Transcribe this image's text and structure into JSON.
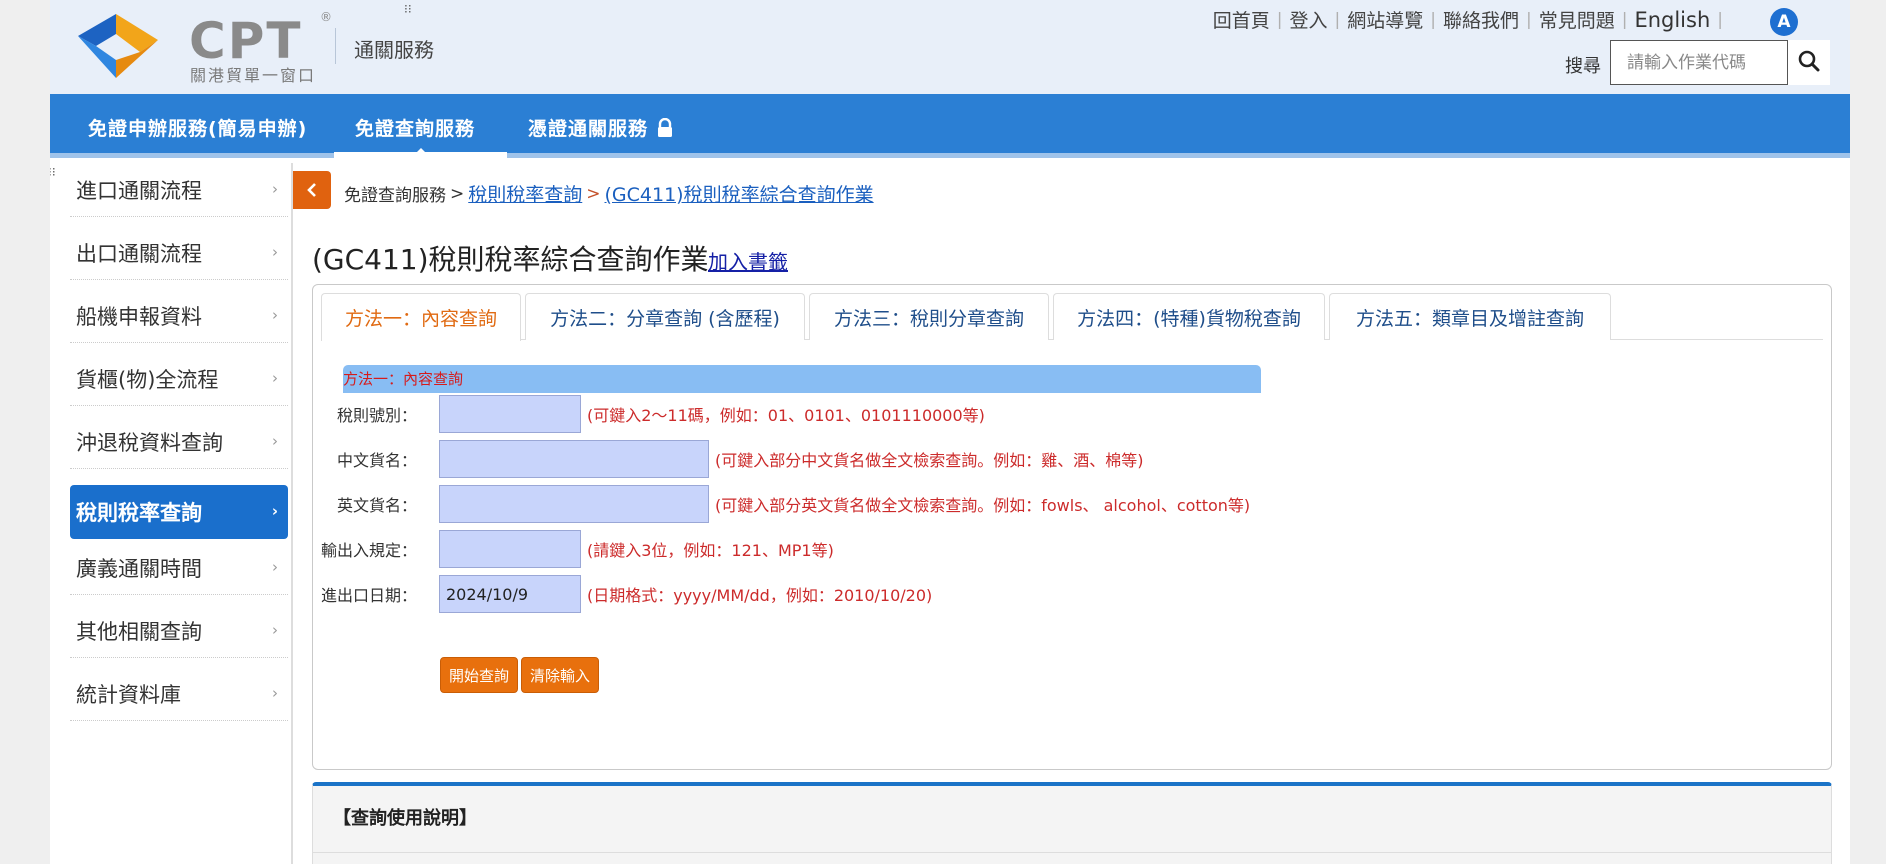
{
  "header": {
    "logo_text": "CPT",
    "logo_reg": "®",
    "logo_subtitle": "關港貿單一窗口",
    "section_title": "通關服務",
    "top_links": [
      "回首頁",
      "登入",
      "網站導覽",
      "聯絡我們",
      "常見問題"
    ],
    "language_link": "English",
    "a11y_badge": "A",
    "search_label": "搜尋",
    "search_placeholder": "請輸入作業代碼"
  },
  "nav": {
    "items": [
      {
        "label": "免證申辦服務(簡易申辦)"
      },
      {
        "label": "免證查詢服務",
        "active": true
      },
      {
        "label": "憑證通關服務",
        "locked": true
      }
    ]
  },
  "sidebar": {
    "items": [
      {
        "label": "進口通關流程"
      },
      {
        "label": "出口通關流程"
      },
      {
        "label": "船機申報資料"
      },
      {
        "label": "貨櫃(物)全流程"
      },
      {
        "label": "沖退稅資料查詢"
      },
      {
        "label": "稅則稅率查詢",
        "active": true
      },
      {
        "label": "廣義通關時間"
      },
      {
        "label": "其他相關查詢"
      },
      {
        "label": "統計資料庫"
      }
    ]
  },
  "breadcrumb": {
    "root": "免證查詢服務",
    "sep": ">",
    "level2": "稅則稅率查詢",
    "level3": "(GC411)稅則稅率綜合查詢作業"
  },
  "page": {
    "title": "(GC411)稅則稅率綜合查詢作業",
    "bookmark": "加入書籤"
  },
  "tabs": [
    {
      "label": "方法一：內容查詢",
      "active": true
    },
    {
      "label": "方法二：分章查詢 (含歷程)"
    },
    {
      "label": "方法三：稅則分章查詢"
    },
    {
      "label": "方法四：(特種)貨物稅查詢"
    },
    {
      "label": "方法五：類章目及增註查詢"
    }
  ],
  "form": {
    "section_label": "方法一：內容查詢",
    "fields": [
      {
        "label": "稅則號別：",
        "value": "",
        "hint": "(可鍵入2～11碼，例如：01、0101、0101110000等)"
      },
      {
        "label": "中文貨名：",
        "value": "",
        "hint": "(可鍵入部分中文貨名做全文檢索查詢。例如：雞、酒、棉等)"
      },
      {
        "label": "英文貨名：",
        "value": "",
        "hint": "(可鍵入部分英文貨名做全文檢索查詢。例如：fowls、 alcohol、cotton等)"
      },
      {
        "label": "輸出入規定：",
        "value": "",
        "hint": "(請鍵入3位，例如：121、MP1等)"
      },
      {
        "label": "進出口日期：",
        "value": "2024/10/9",
        "hint": "(日期格式：yyyy/MM/dd，例如：2010/10/20)"
      }
    ],
    "submit_label": "開始查詢",
    "clear_label": "清除輸入"
  },
  "instructions": {
    "title": "【查詢使用說明】"
  },
  "colors": {
    "nav_blue": "#2b7fd4",
    "accent_orange": "#e8700d",
    "hint_red": "#cc2b2b",
    "input_fill": "#c8d4fb"
  }
}
